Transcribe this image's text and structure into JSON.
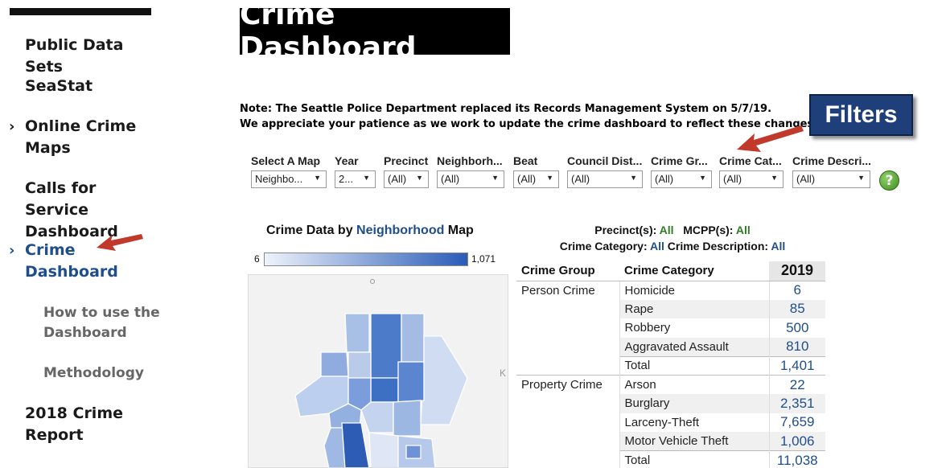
{
  "sidebar": {
    "items": [
      {
        "label": "Public Data Sets"
      },
      {
        "label": "SeaStat"
      },
      {
        "label_line1": "Online Crime",
        "label_line2": "Maps"
      },
      {
        "label_line1": "Calls for Service",
        "label_line2": "Dashboard"
      },
      {
        "label_line1": "Crime",
        "label_line2": "Dashboard"
      },
      {
        "label_line1": "2018 Crime",
        "label_line2": "Report"
      }
    ],
    "subitems": [
      {
        "label_line1": "How to use the",
        "label_line2": "Dashboard"
      },
      {
        "label": "Methodology"
      }
    ],
    "active_color": "#1f4e8c"
  },
  "header": {
    "title": "Crime Dashboard",
    "note_line1": "Note: The Seattle Police Department replaced its Records Management System on 5/7/19.",
    "note_line2": "We appreciate your patience as we work to update the crime dashboard to reflect these changes."
  },
  "callout": {
    "label": "Filters"
  },
  "filters": [
    {
      "label": "Select A Map",
      "value": "Neighbo..."
    },
    {
      "label": "Year",
      "value": "2..."
    },
    {
      "label": "Precinct",
      "value": "(All)"
    },
    {
      "label": "Neighborh...",
      "value": "(All)"
    },
    {
      "label": "Beat",
      "value": "(All)"
    },
    {
      "label": "Council Dist...",
      "value": "(All)"
    },
    {
      "label": "Crime Gr...",
      "value": "(All)"
    },
    {
      "label": "Crime Cat...",
      "value": "(All)"
    },
    {
      "label": "Crime Descri...",
      "value": "(All)"
    }
  ],
  "help": {
    "glyph": "?"
  },
  "map_panel": {
    "title_pre": "Crime Data by ",
    "title_hl": "Neighborhood",
    "title_post": " Map",
    "legend_min": "6",
    "legend_max": "1,071",
    "letter_k": "K"
  },
  "summary": {
    "precinct_label": "Precinct(s):",
    "precinct_value": "All",
    "mcpp_label": "MCPP(s):",
    "mcpp_value": "All",
    "category_label": "Crime Category:",
    "category_value": "All",
    "description_label": "Crime Description:",
    "description_value": "All"
  },
  "table": {
    "headers": {
      "group": "Crime Group",
      "category": "Crime Category",
      "year": "2019"
    },
    "groups": [
      {
        "name": "Person Crime",
        "rows": [
          {
            "category": "Homicide",
            "value": "6"
          },
          {
            "category": "Rape",
            "value": "85"
          },
          {
            "category": "Robbery",
            "value": "500"
          },
          {
            "category": "Aggravated Assault",
            "value": "810"
          },
          {
            "category": "Total",
            "value": "1,401"
          }
        ]
      },
      {
        "name": "Property Crime",
        "rows": [
          {
            "category": "Arson",
            "value": "22"
          },
          {
            "category": "Burglary",
            "value": "2,351"
          },
          {
            "category": "Larceny-Theft",
            "value": "7,659"
          },
          {
            "category": "Motor Vehicle Theft",
            "value": "1,006"
          },
          {
            "category": "Total",
            "value": "11,038"
          }
        ]
      }
    ]
  },
  "colors": {
    "accent": "#1f4e8c",
    "arrow": "#c0392b",
    "callout_bg": "#1f3f7a",
    "green": "#2e7d22"
  }
}
